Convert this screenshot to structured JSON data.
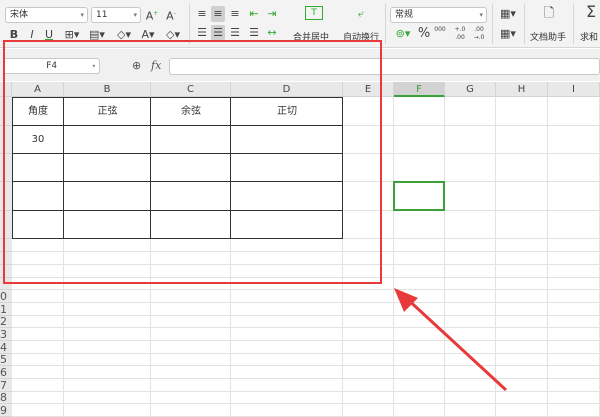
{
  "toolbar": {
    "font_name": "宋体",
    "font_size": "11",
    "merge_center": "合并居中",
    "wrap_text": "自动换行",
    "number_format": "常规",
    "doc_helper": "文档助手",
    "sum": "求和",
    "bold": "B",
    "italic": "I",
    "underline": "U",
    "percent": "%",
    "thousands": "000",
    "inc_decimal": "+.0 .00",
    "dec_decimal": ".00 →.0"
  },
  "formula_bar": {
    "name_box": "F4",
    "fx": "fx",
    "value": ""
  },
  "columns": [
    "A",
    "B",
    "C",
    "D",
    "E",
    "F",
    "G",
    "H",
    "I"
  ],
  "active_column": "F",
  "row_labels": [
    "",
    "",
    "",
    "",
    "",
    "",
    "",
    "",
    "",
    "0",
    "1",
    "2",
    "3",
    "4",
    "5",
    "6",
    "7",
    "8",
    "9"
  ],
  "table": {
    "headers": [
      "角度",
      "正弦",
      "余弦",
      "正切"
    ],
    "rows": [
      [
        "30",
        "",
        "",
        ""
      ],
      [
        "",
        "",
        "",
        ""
      ],
      [
        "",
        "",
        "",
        ""
      ],
      [
        "",
        "",
        "",
        ""
      ]
    ]
  },
  "selected_cell": "F4",
  "colors": {
    "highlight": "#e83a3a",
    "selection": "#3aa13a"
  }
}
